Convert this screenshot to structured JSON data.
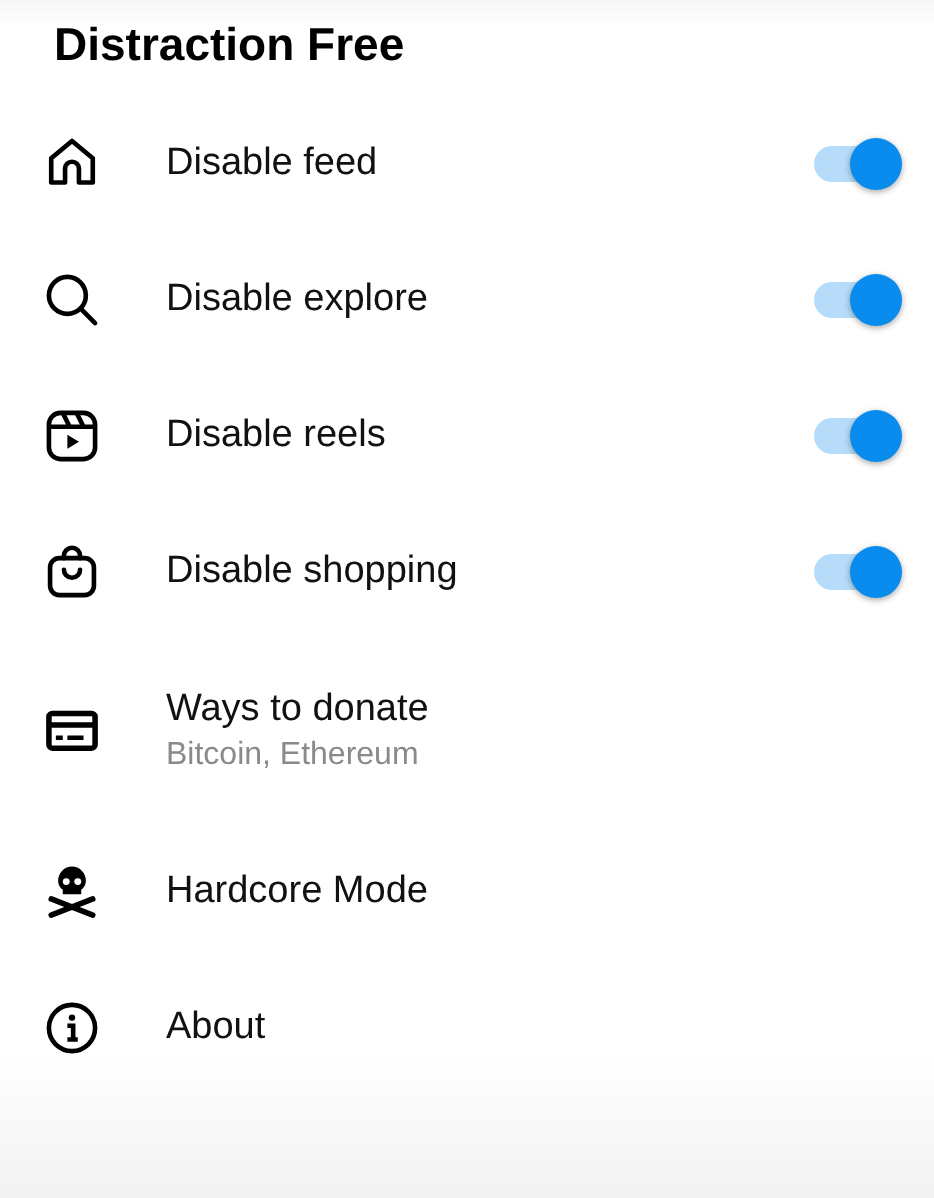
{
  "title": "Distraction Free",
  "items": [
    {
      "kind": "toggle",
      "label": "Disable feed",
      "on": true
    },
    {
      "kind": "toggle",
      "label": "Disable explore",
      "on": true
    },
    {
      "kind": "toggle",
      "label": "Disable reels",
      "on": true
    },
    {
      "kind": "toggle",
      "label": "Disable shopping",
      "on": true
    },
    {
      "kind": "link",
      "label": "Ways to donate",
      "subtitle": "Bitcoin, Ethereum"
    },
    {
      "kind": "link",
      "label": "Hardcore Mode"
    },
    {
      "kind": "link",
      "label": "About"
    }
  ]
}
